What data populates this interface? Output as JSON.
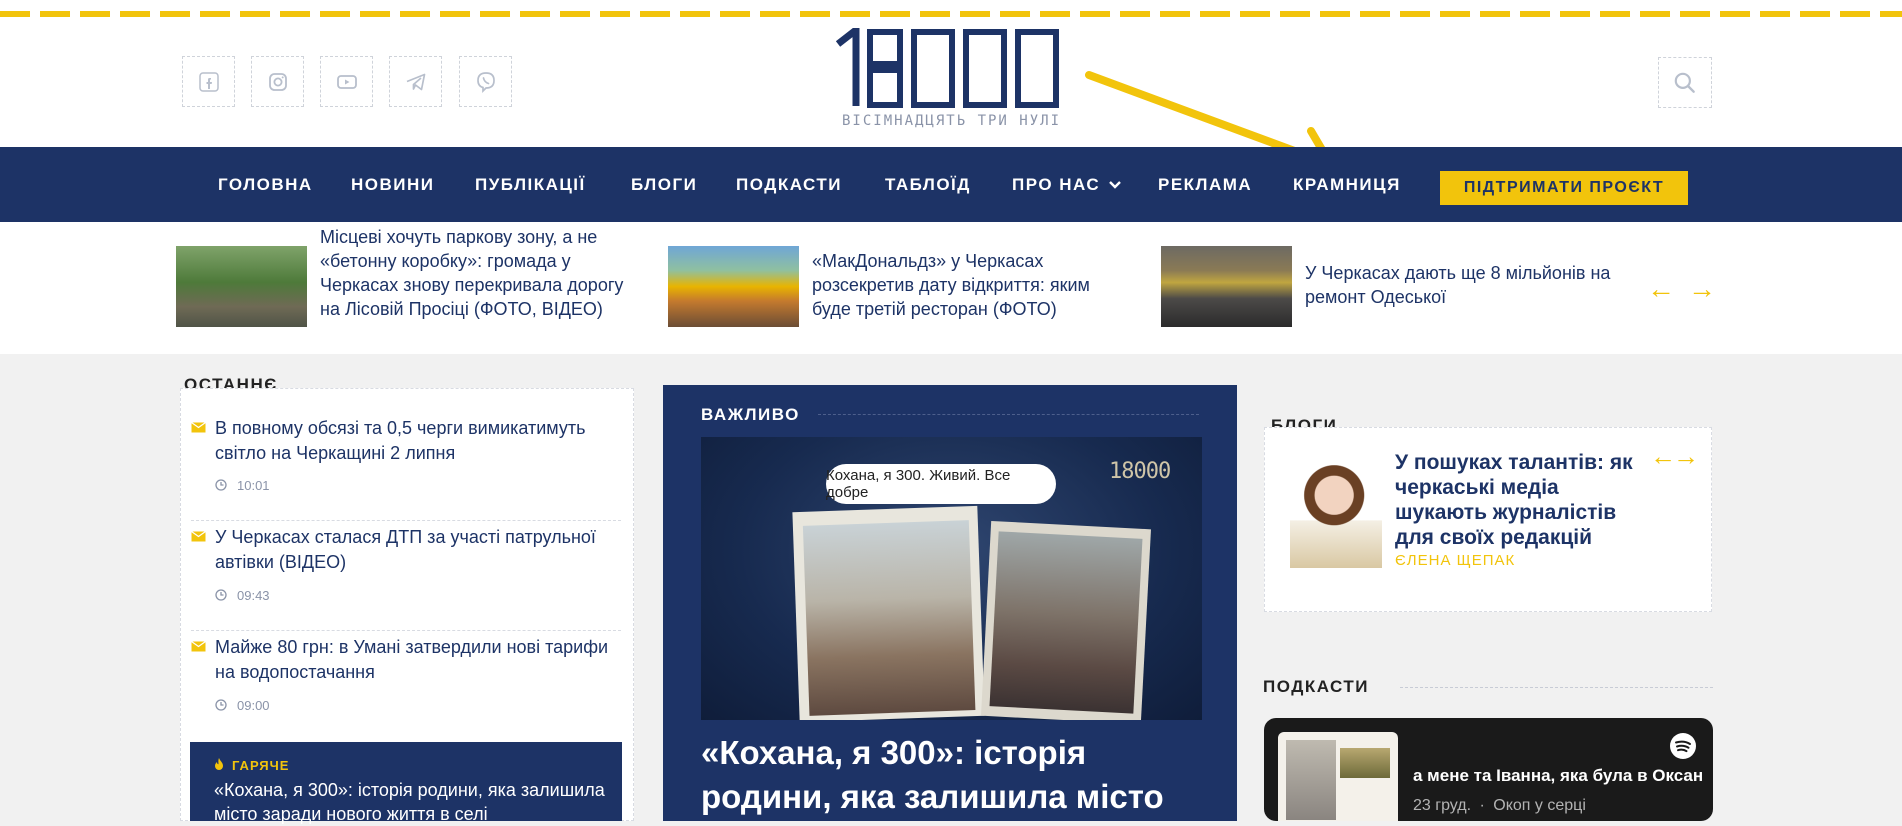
{
  "site": {
    "logo_text": "18000",
    "tagline": "ВІСІМНАДЦЯТЬ ТРИ НУЛІ",
    "brand_color": "#1d3366",
    "accent_color": "#f2c40c"
  },
  "social": [
    "facebook-icon",
    "instagram-icon",
    "youtube-icon",
    "telegram-icon",
    "viber-icon"
  ],
  "nav": {
    "items": [
      "ГОЛОВНА",
      "НОВИНИ",
      "ПУБЛІКАЦІЇ",
      "БЛОГИ",
      "ПОДКАСТИ",
      "ТАБЛОЇД",
      "ПРО НАС",
      "РЕКЛАМА",
      "КРАМНИЦЯ"
    ],
    "support_label": "ПІДТРИМАТИ ПРОЄКТ"
  },
  "ticker": [
    {
      "title": "Місцеві хочуть паркову зону, а не «бетонну коробку»: громада у Черкасах знову перекривала дорогу на Лісовій Просіці (ФОТО, ВІДЕО)"
    },
    {
      "title": "«МакДональдз» у Черкасах розсекретив дату відкриття: яким буде третій ресторан (ФОТО)"
    },
    {
      "title": "У Черкасах дають ще 8 мільйонів на ремонт Одеської"
    }
  ],
  "latest": {
    "heading": "ОСТАННЄ",
    "items": [
      {
        "title": "В повному обсязі та 0,5 черги вимикатимуть світло на Черкащині 2 липня",
        "time": "10:01"
      },
      {
        "title": "У Черкасах сталася ДТП за участі патрульної автівки (ВІДЕО)",
        "time": "09:43"
      },
      {
        "title": "Майже 80 грн: в Умані затвердили нові тарифи на водопостачання",
        "time": "09:00"
      }
    ],
    "hot_label": "ГАРЯЧЕ",
    "hot_title": "«Кохана, я 300»: історія родини, яка залишила місто заради нового життя в селі"
  },
  "featured": {
    "label": "ВАЖЛИВО",
    "image_caption": "Кохана, я 300. Живий. Все добре",
    "image_logo": "18000",
    "title": "«Кохана, я 300»: історія родини, яка залишила місто"
  },
  "blogs": {
    "heading": "БЛОГИ",
    "title": "У пошуках талантів: як черкаські медіа шукають журналістів для своїх редакцій",
    "author": "ЄЛЕНА ЩЕПАК"
  },
  "podcasts": {
    "heading": "ПОДКАСТИ",
    "episode": "а мене та Іванна, яка була в Оксан",
    "date": "23 груд.",
    "show": "Окоп у серці"
  }
}
